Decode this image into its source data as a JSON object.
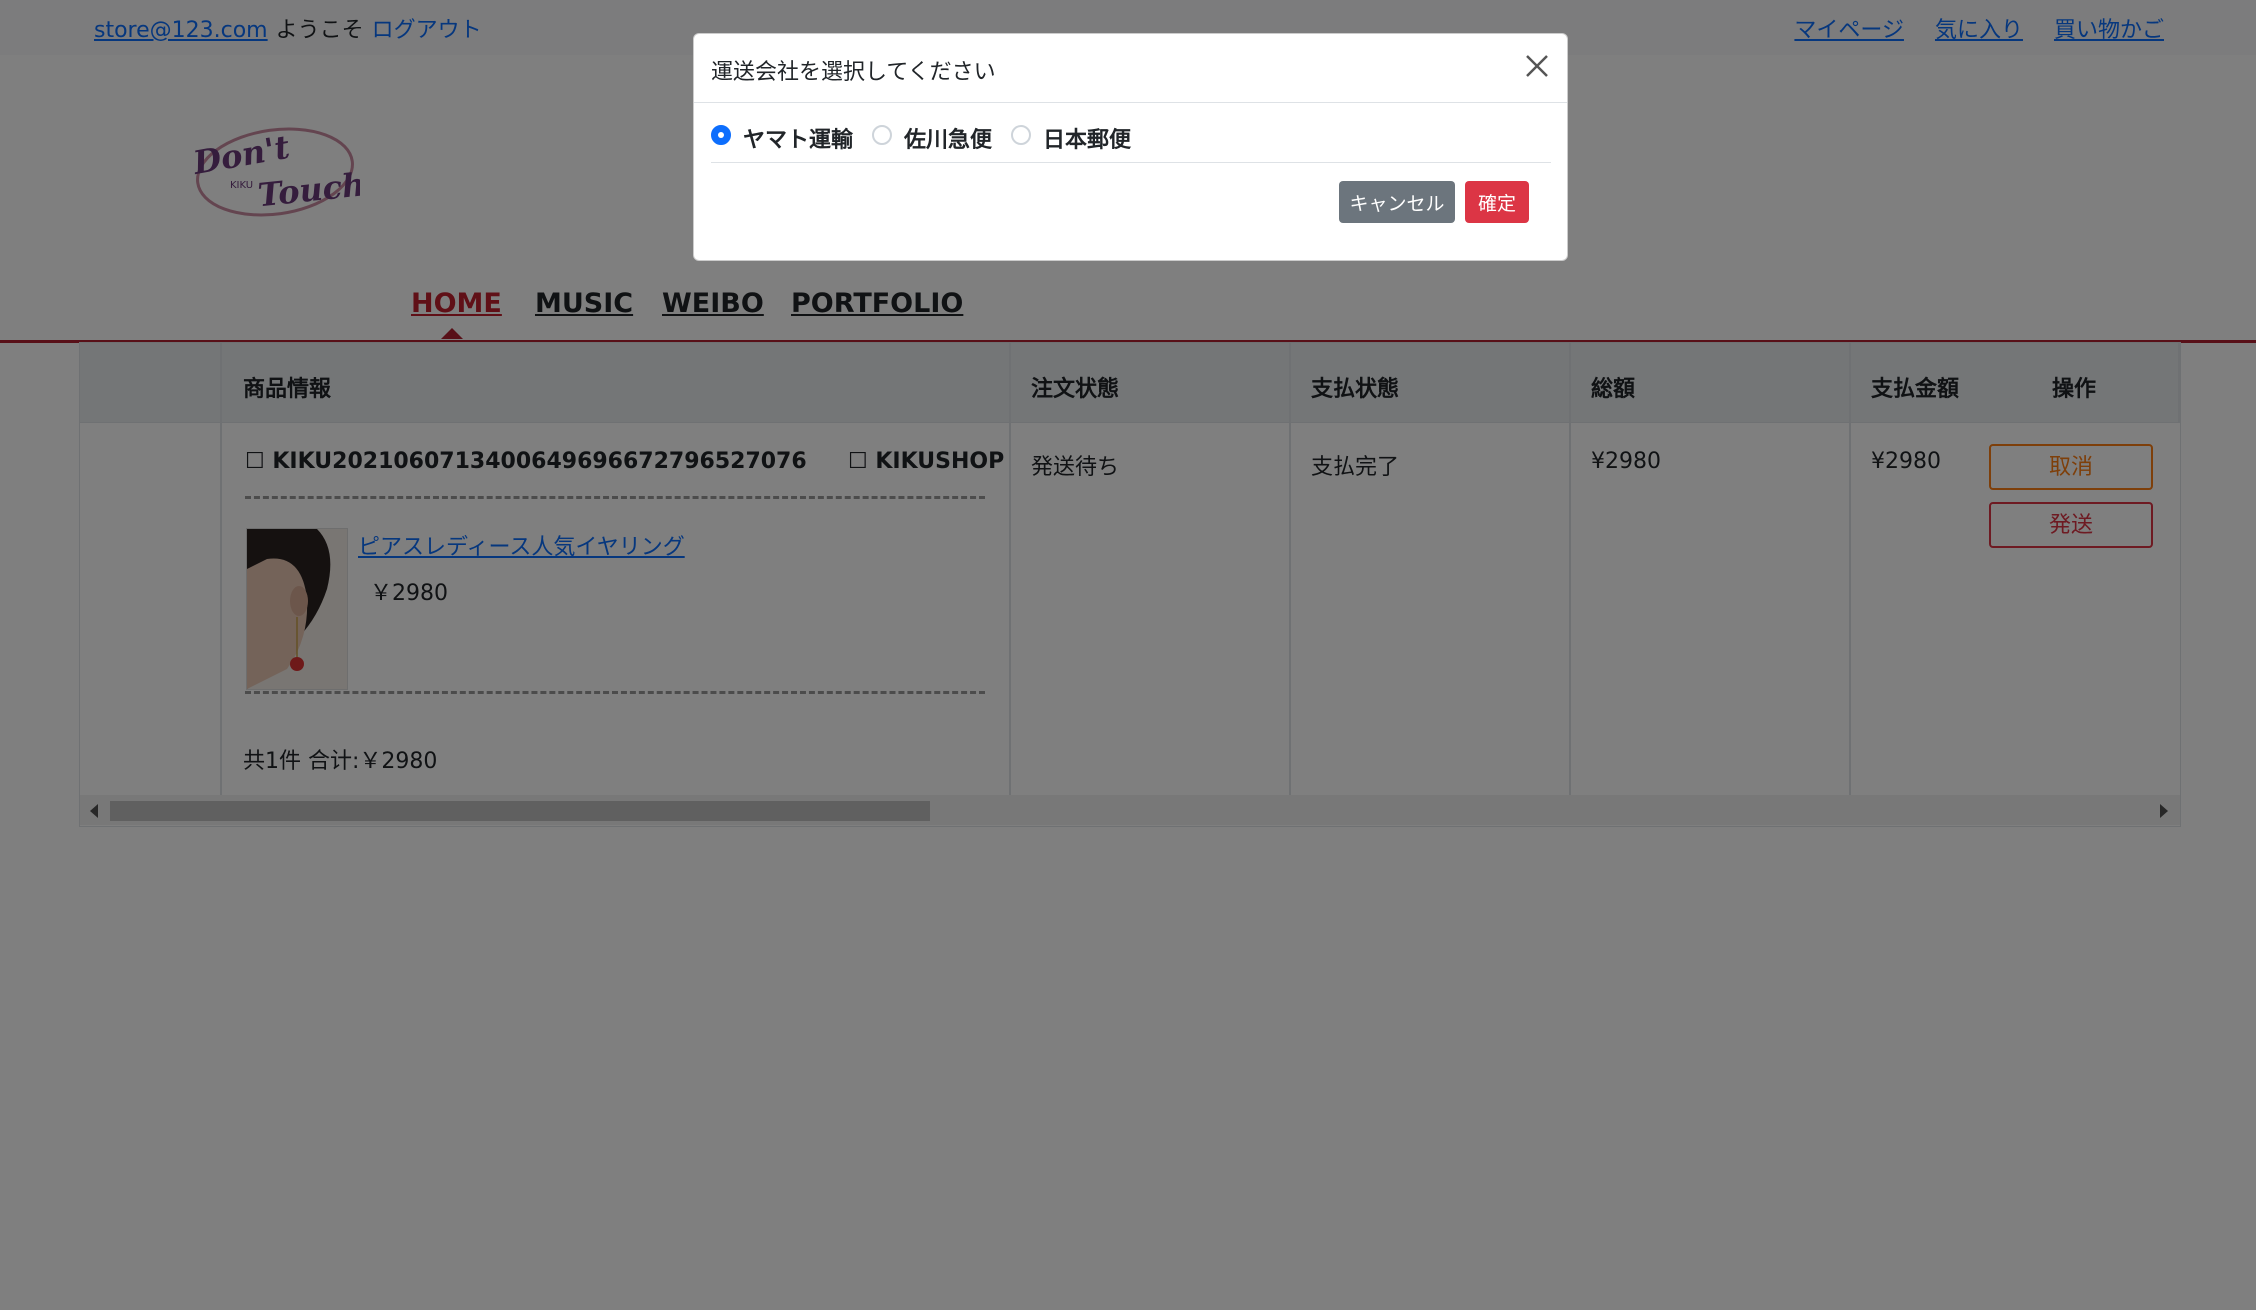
{
  "topbar": {
    "email": "store@123.com",
    "welcome": "ようこそ",
    "logout": "ログアウト",
    "links": [
      "マイページ",
      "気に入り",
      "買い物かご"
    ]
  },
  "logo": {
    "line1": "Don't",
    "line2": "Touch",
    "small": "KIKU"
  },
  "nav": {
    "items": [
      "HOME",
      "MUSIC",
      "WEIBO",
      "PORTFOLIO"
    ],
    "active": "HOME"
  },
  "table": {
    "headers": [
      "商品情報",
      "注文状態",
      "支払状態",
      "総額",
      "支払金額",
      "操作"
    ],
    "order": {
      "order_no": "☐ KIKU20210607134006496966727965270​76",
      "shop": "☐ KIKUSHOP",
      "product_name": "ピアスレディース人気イヤリング",
      "product_price": "￥2980",
      "summary": "共1件 合计:￥2980",
      "order_status": "発送待ち",
      "payment_status": "支払完了",
      "total": "¥2980",
      "paid": "¥2980",
      "cancel_label": "取消",
      "ship_label": "発送"
    }
  },
  "modal": {
    "title": "運送会社を選択してください",
    "options": [
      "ヤマト運輸",
      "佐川急便",
      "日本郵便"
    ],
    "selected": "ヤマト運輸",
    "cancel_label": "キャンセル",
    "confirm_label": "確定"
  },
  "colors": {
    "accent": "#c0212f",
    "link": "#0d6efd",
    "confirm": "#dc3545",
    "cancel": "#6c757d"
  }
}
